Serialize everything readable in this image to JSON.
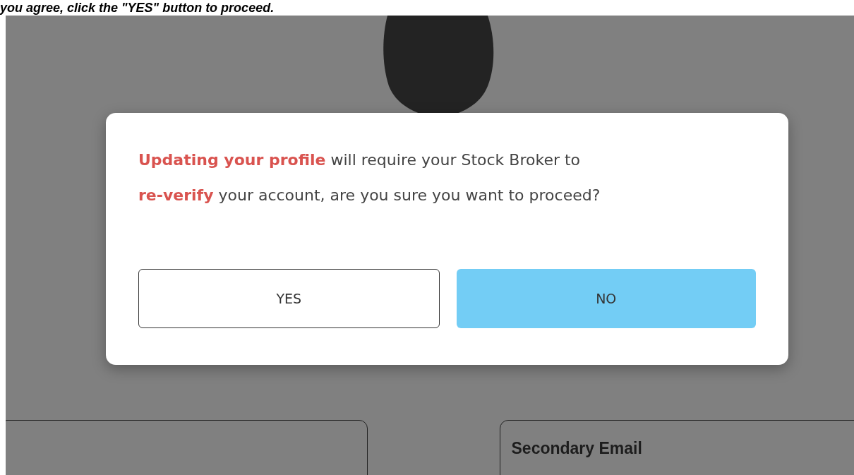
{
  "caption": "you agree, click the \"YES\" button to proceed.",
  "dialog": {
    "message_lines": [
      "**Updating your profile** will require your Stock Broker to",
      "**re-verify** your account, are you sure you want to proceed?"
    ],
    "buttons": [
      {
        "label": "YES",
        "kind": "outline"
      },
      {
        "label": "NO",
        "kind": "filled"
      }
    ]
  },
  "fields": [
    {
      "kind": "blank"
    },
    {
      "kind": "labeled",
      "label": "Secondary Email"
    }
  ]
}
